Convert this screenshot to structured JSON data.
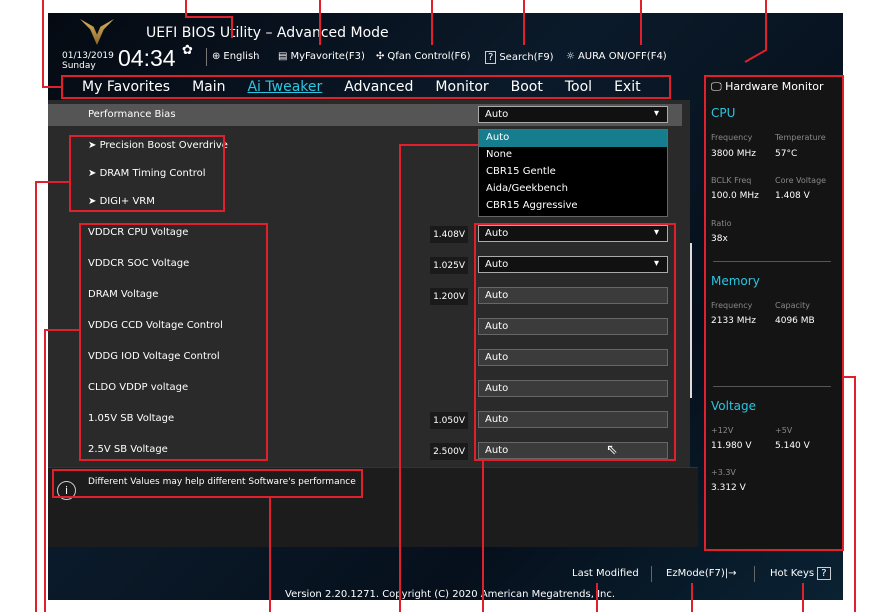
{
  "header": {
    "title": "UEFI BIOS Utility – Advanced Mode",
    "date": "01/13/2019",
    "day": "Sunday",
    "time": "04:34",
    "tools": [
      {
        "icon": "globe-icon",
        "label": "English"
      },
      {
        "icon": "favorite-icon",
        "label": "MyFavorite(F3)"
      },
      {
        "icon": "fan-icon",
        "label": "Qfan Control(F6)"
      },
      {
        "icon": "search-icon",
        "label": "Search(F9)"
      },
      {
        "icon": "aura-icon",
        "label": "AURA ON/OFF(F4)"
      }
    ]
  },
  "menu": [
    "My Favorites",
    "Main",
    "Ai Tweaker",
    "Advanced",
    "Monitor",
    "Boot",
    "Tool",
    "Exit"
  ],
  "main": {
    "perf_bias": {
      "label": "Performance Bias",
      "value": "Auto"
    },
    "dropdown_options": [
      "Auto",
      "None",
      "CBR15 Gentle",
      "Aida/Geekbench",
      "CBR15 Aggressive"
    ],
    "submenus": [
      "Precision Boost Overdrive",
      "DRAM Timing Control",
      "DIGI+ VRM"
    ],
    "settings": [
      {
        "label": "VDDCR CPU Voltage",
        "reading": "1.408V",
        "value": "Auto"
      },
      {
        "label": "VDDCR SOC Voltage",
        "reading": "1.025V",
        "value": "Auto"
      },
      {
        "label": "DRAM Voltage",
        "reading": "1.200V",
        "value": "Auto"
      },
      {
        "label": "VDDG CCD Voltage Control",
        "reading": "",
        "value": "Auto"
      },
      {
        "label": "VDDG IOD Voltage Control",
        "reading": "",
        "value": "Auto"
      },
      {
        "label": "CLDO VDDP voltage",
        "reading": "",
        "value": "Auto"
      },
      {
        "label": "1.05V SB Voltage",
        "reading": "1.050V",
        "value": "Auto"
      },
      {
        "label": "2.5V SB Voltage",
        "reading": "2.500V",
        "value": "Auto"
      }
    ],
    "info": "Different Values may help different Software's performance"
  },
  "hw": {
    "title": "Hardware Monitor",
    "cpu": "CPU",
    "freq_k": "Frequency",
    "freq": "3800 MHz",
    "temp_k": "Temperature",
    "temp": "57°C",
    "bclk_k": "BCLK Freq",
    "bclk": "100.0 MHz",
    "cv_k": "Core Voltage",
    "cv": "1.408 V",
    "ratio_k": "Ratio",
    "ratio": "38x",
    "memory": "Memory",
    "mfreq_k": "Frequency",
    "mfreq": "2133 MHz",
    "cap_k": "Capacity",
    "cap": "4096 MB",
    "voltage": "Voltage",
    "v12_k": "+12V",
    "v12": "11.980 V",
    "v5_k": "+5V",
    "v5": "5.140 V",
    "v33_k": "+3.3V",
    "v33": "3.312 V"
  },
  "footer": {
    "last_modified": "Last Modified",
    "ezmode": "EzMode(F7)|→",
    "hotkeys": "Hot Keys",
    "version": "Version 2.20.1271. Copyright (C) 2020 American Megatrends, Inc."
  },
  "colors": {
    "accent": "#2bc5e0",
    "annotation": "#e0202a",
    "highlight": "#167d8e"
  }
}
